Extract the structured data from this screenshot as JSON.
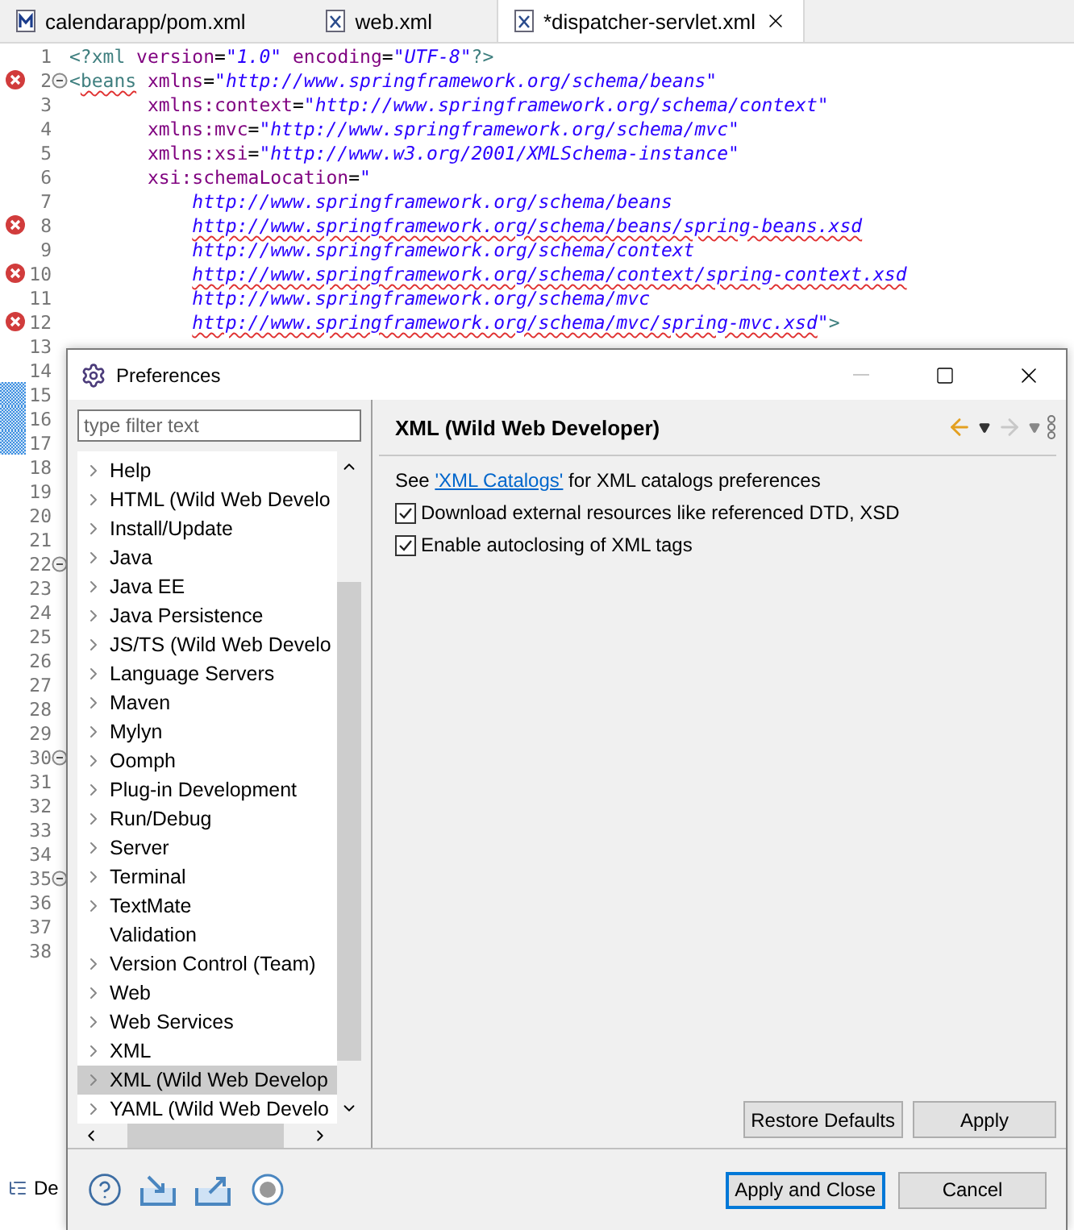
{
  "editor": {
    "tabs": [
      {
        "label": "calendarapp/pom.xml",
        "kind": "maven",
        "selected": false
      },
      {
        "label": "web.xml",
        "kind": "xml",
        "selected": false
      },
      {
        "label": "*dispatcher-servlet.xml",
        "kind": "xml",
        "selected": true
      }
    ],
    "lines": [
      {
        "number": "1",
        "kind": "root",
        "tokens": [
          {
            "kind": "tag",
            "text": "<?xml"
          },
          {
            "kind": "attr",
            "text": " version"
          },
          {
            "kind": "punct",
            "text": "="
          },
          {
            "kind": "string",
            "text": "\"1.0\""
          },
          {
            "kind": "attr",
            "text": " encoding"
          },
          {
            "kind": "punct",
            "text": "="
          },
          {
            "kind": "string",
            "text": "\"UTF-8\""
          },
          {
            "kind": "tag",
            "text": "?>"
          }
        ]
      },
      {
        "number": "2",
        "kind": "root",
        "error": true,
        "fold": true,
        "tokens": [
          {
            "kind": "tag",
            "text": "<"
          },
          {
            "kind": "tag",
            "text": "beans",
            "squiggle": true
          },
          {
            "kind": "attr",
            "text": " xmlns"
          },
          {
            "kind": "punct",
            "text": "="
          },
          {
            "kind": "string",
            "text": "\"http://www.springframework.org/schema/beans\""
          }
        ]
      },
      {
        "number": "3",
        "kind": "attribute",
        "tokens": [
          {
            "kind": "attr",
            "text": "xmlns:context"
          },
          {
            "kind": "punct",
            "text": "="
          },
          {
            "kind": "string",
            "text": "\"http://www.springframework.org/schema/context\""
          }
        ]
      },
      {
        "number": "4",
        "kind": "attribute",
        "tokens": [
          {
            "kind": "attr",
            "text": "xmlns:mvc"
          },
          {
            "kind": "punct",
            "text": "="
          },
          {
            "kind": "string",
            "text": "\"http://www.springframework.org/schema/mvc\""
          }
        ]
      },
      {
        "number": "5",
        "kind": "attribute",
        "tokens": [
          {
            "kind": "attr",
            "text": "xmlns:xsi"
          },
          {
            "kind": "punct",
            "text": "="
          },
          {
            "kind": "string",
            "text": "\"http://www.w3.org/2001/XMLSchema-instance\""
          }
        ]
      },
      {
        "number": "6",
        "kind": "attribute",
        "tokens": [
          {
            "kind": "attr",
            "text": "xsi:schemaLocation"
          },
          {
            "kind": "punct",
            "text": "="
          },
          {
            "kind": "string",
            "text": "\""
          }
        ]
      },
      {
        "number": "7",
        "kind": "value",
        "tokens": [
          {
            "kind": "string",
            "text": "http://www.springframework.org/schema/beans"
          }
        ]
      },
      {
        "number": "8",
        "kind": "value",
        "error": true,
        "tokens": [
          {
            "kind": "string",
            "text": "http://www.springframework.org/schema/beans/spring-beans.xsd",
            "squiggle": true
          }
        ]
      },
      {
        "number": "9",
        "kind": "value",
        "tokens": [
          {
            "kind": "string",
            "text": "http://www.springframework.org/schema/context"
          }
        ]
      },
      {
        "number": "10",
        "kind": "value",
        "error": true,
        "tokens": [
          {
            "kind": "string",
            "text": "http://www.springframework.org/schema/context/spring-context.xsd",
            "squiggle": true
          }
        ]
      },
      {
        "number": "11",
        "kind": "value",
        "tokens": [
          {
            "kind": "string",
            "text": "http://www.springframework.org/schema/mvc"
          }
        ]
      },
      {
        "number": "12",
        "kind": "value",
        "error": true,
        "tokens": [
          {
            "kind": "string",
            "text": "http://www.springframework.org/schema/mvc/spring-mvc.xsd",
            "squiggle": true
          },
          {
            "kind": "string",
            "text": "\""
          },
          {
            "kind": "tag",
            "text": ">"
          }
        ]
      },
      {
        "number": "13"
      },
      {
        "number": "14"
      },
      {
        "number": "15",
        "changed": true
      },
      {
        "number": "16",
        "changed": true
      },
      {
        "number": "17",
        "changed": true
      },
      {
        "number": "18"
      },
      {
        "number": "19"
      },
      {
        "number": "20"
      },
      {
        "number": "21"
      },
      {
        "number": "22",
        "fold": true
      },
      {
        "number": "23"
      },
      {
        "number": "24"
      },
      {
        "number": "25"
      },
      {
        "number": "26"
      },
      {
        "number": "27"
      },
      {
        "number": "28"
      },
      {
        "number": "29"
      },
      {
        "number": "30",
        "fold": true
      },
      {
        "number": "31"
      },
      {
        "number": "32"
      },
      {
        "number": "33"
      },
      {
        "number": "34"
      },
      {
        "number": "35",
        "fold": true
      },
      {
        "number": "36"
      },
      {
        "number": "37"
      },
      {
        "number": "38"
      }
    ]
  },
  "bottom_view": {
    "label": "De"
  },
  "dialog": {
    "title": "Preferences",
    "filter": {
      "placeholder": "type filter text"
    },
    "tree": [
      {
        "label": "Help",
        "expandable": true,
        "selected": false
      },
      {
        "label": "HTML (Wild Web Develo",
        "expandable": true,
        "selected": false
      },
      {
        "label": "Install/Update",
        "expandable": true,
        "selected": false
      },
      {
        "label": "Java",
        "expandable": true,
        "selected": false
      },
      {
        "label": "Java EE",
        "expandable": true,
        "selected": false
      },
      {
        "label": "Java Persistence",
        "expandable": true,
        "selected": false
      },
      {
        "label": "JS/TS (Wild Web Develo",
        "expandable": true,
        "selected": false
      },
      {
        "label": "Language Servers",
        "expandable": true,
        "selected": false
      },
      {
        "label": "Maven",
        "expandable": true,
        "selected": false
      },
      {
        "label": "Mylyn",
        "expandable": true,
        "selected": false
      },
      {
        "label": "Oomph",
        "expandable": true,
        "selected": false
      },
      {
        "label": "Plug-in Development",
        "expandable": true,
        "selected": false
      },
      {
        "label": "Run/Debug",
        "expandable": true,
        "selected": false
      },
      {
        "label": "Server",
        "expandable": true,
        "selected": false
      },
      {
        "label": "Terminal",
        "expandable": true,
        "selected": false
      },
      {
        "label": "TextMate",
        "expandable": true,
        "selected": false
      },
      {
        "label": "Validation",
        "expandable": false,
        "selected": false
      },
      {
        "label": "Version Control (Team)",
        "expandable": true,
        "selected": false
      },
      {
        "label": "Web",
        "expandable": true,
        "selected": false
      },
      {
        "label": "Web Services",
        "expandable": true,
        "selected": false
      },
      {
        "label": "XML",
        "expandable": true,
        "selected": false
      },
      {
        "label": "XML (Wild Web Develop",
        "expandable": true,
        "selected": true
      },
      {
        "label": "YAML (Wild Web Develo",
        "expandable": true,
        "selected": false
      }
    ],
    "page": {
      "title": "XML (Wild Web Developer)",
      "intro": {
        "before": "See ",
        "link": "'XML Catalogs'",
        "after": " for XML catalogs preferences"
      },
      "options": [
        {
          "label": "Download external resources like referenced DTD, XSD",
          "checked": true
        },
        {
          "label": "Enable autoclosing of XML tags",
          "checked": true
        }
      ],
      "buttons": [
        "Restore Defaults",
        "Apply"
      ]
    },
    "footer_buttons": [
      {
        "label": "Apply and Close",
        "default": true
      },
      {
        "label": "Cancel",
        "default": false
      }
    ]
  }
}
